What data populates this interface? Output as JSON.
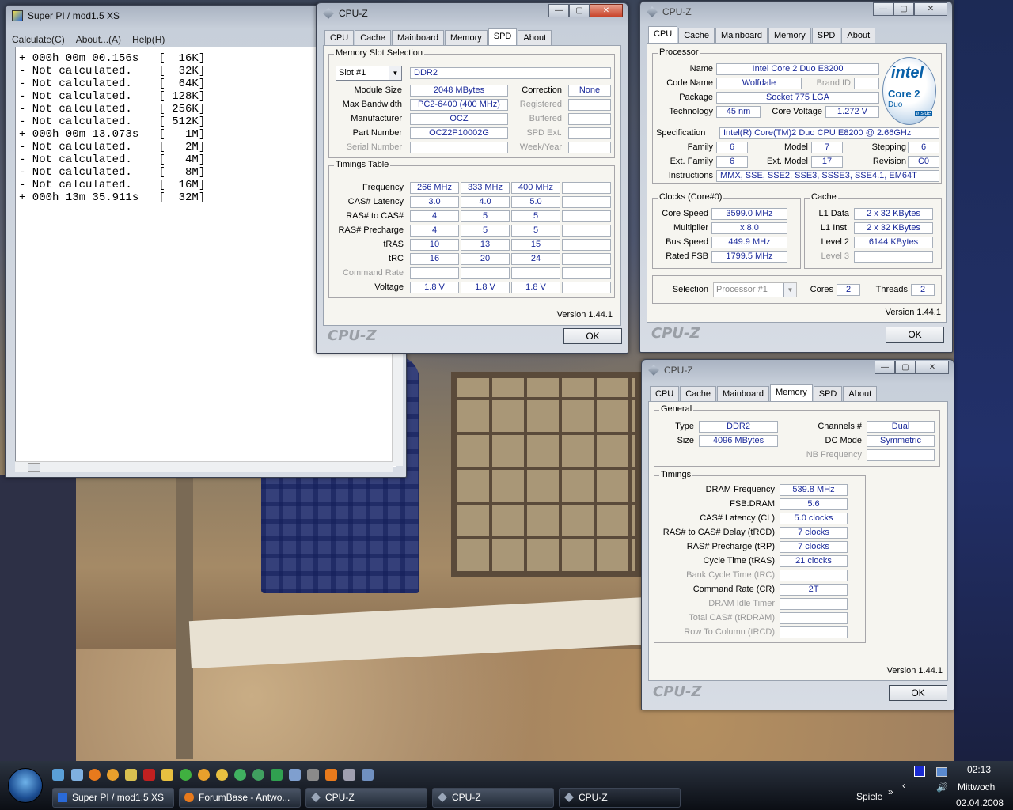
{
  "superpi": {
    "title": "Super PI / mod1.5 XS",
    "menu": [
      "Calculate(C)",
      "About...(A)",
      "Help(H)"
    ],
    "lines": [
      "+ 000h 00m 00.156s   [  16K]",
      "- Not calculated.    [  32K]",
      "- Not calculated.    [  64K]",
      "- Not calculated.    [ 128K]",
      "- Not calculated.    [ 256K]",
      "- Not calculated.    [ 512K]",
      "+ 000h 00m 13.073s   [   1M]",
      "- Not calculated.    [   2M]",
      "- Not calculated.    [   4M]",
      "- Not calculated.    [   8M]",
      "- Not calculated.    [  16M]",
      "+ 000h 13m 35.911s   [  32M]"
    ]
  },
  "cpuz_common": {
    "title": "CPU-Z",
    "brand": "CPU-Z",
    "version": "Version 1.44.1",
    "ok": "OK",
    "tabs": [
      "CPU",
      "Cache",
      "Mainboard",
      "Memory",
      "SPD",
      "About"
    ]
  },
  "spd": {
    "slot_group": "Memory Slot Selection",
    "slot": "Slot #1",
    "type": "DDR2",
    "labels_left": [
      "Module Size",
      "Max Bandwidth",
      "Manufacturer",
      "Part Number",
      "Serial Number"
    ],
    "values_left": [
      "2048 MBytes",
      "PC2-6400 (400 MHz)",
      "OCZ",
      "OCZ2P10002G",
      ""
    ],
    "labels_right": [
      "Correction",
      "Registered",
      "Buffered",
      "SPD Ext.",
      "Week/Year"
    ],
    "values_right": [
      "None",
      "",
      "",
      "",
      ""
    ],
    "timings_group": "Timings Table",
    "timing_labels": [
      "Frequency",
      "CAS# Latency",
      "RAS# to CAS#",
      "RAS# Precharge",
      "tRAS",
      "tRC",
      "Command Rate",
      "Voltage"
    ],
    "timing_cols": [
      [
        "266 MHz",
        "3.0",
        "4",
        "4",
        "10",
        "16",
        "",
        "1.8 V"
      ],
      [
        "333 MHz",
        "4.0",
        "5",
        "5",
        "13",
        "20",
        "",
        "1.8 V"
      ],
      [
        "400 MHz",
        "5.0",
        "5",
        "5",
        "15",
        "24",
        "",
        "1.8 V"
      ],
      [
        "",
        "",
        "",
        "",
        "",
        "",
        "",
        ""
      ]
    ]
  },
  "cpu": {
    "processor_group": "Processor",
    "name": "Intel Core 2 Duo E8200",
    "code_name": "Wolfdale",
    "brand_id_label": "Brand ID",
    "package": "Socket 775 LGA",
    "technology": "45 nm",
    "core_voltage_label": "Core Voltage",
    "core_voltage": "1.272 V",
    "spec_label": "Specification",
    "spec": "Intel(R) Core(TM)2 Duo CPU    E8200  @ 2.66GHz",
    "family": "6",
    "model": "7",
    "stepping": "6",
    "ext_family": "6",
    "ext_model": "17",
    "revision": "C0",
    "instructions": "MMX, SSE, SSE2, SSE3, SSSE3, SSE4.1, EM64T",
    "labels": {
      "name": "Name",
      "code_name": "Code Name",
      "package": "Package",
      "technology": "Technology",
      "family": "Family",
      "model": "Model",
      "stepping": "Stepping",
      "ext_family": "Ext. Family",
      "ext_model": "Ext. Model",
      "revision": "Revision",
      "instructions": "Instructions"
    },
    "clocks_group": "Clocks (Core#0)",
    "clock_labels": [
      "Core Speed",
      "Multiplier",
      "Bus Speed",
      "Rated FSB"
    ],
    "clock_values": [
      "3599.0 MHz",
      "x 8.0",
      "449.9 MHz",
      "1799.5 MHz"
    ],
    "cache_group": "Cache",
    "cache_labels": [
      "L1 Data",
      "L1 Inst.",
      "Level 2",
      "Level 3"
    ],
    "cache_values": [
      "2 x 32 KBytes",
      "2 x 32 KBytes",
      "6144 KBytes",
      ""
    ],
    "selection_label": "Selection",
    "selection": "Processor #1",
    "cores_label": "Cores",
    "cores": "2",
    "threads_label": "Threads",
    "threads": "2",
    "logo": {
      "brand": "intel",
      "line1": "Core 2",
      "line2": "Duo",
      "tag": "inside"
    }
  },
  "memory": {
    "general_group": "General",
    "type_label": "Type",
    "type": "DDR2",
    "size_label": "Size",
    "size": "4096 MBytes",
    "channels_label": "Channels #",
    "channels": "Dual",
    "dcmode_label": "DC Mode",
    "dcmode": "Symmetric",
    "nbfreq_label": "NB Frequency",
    "nbfreq": "",
    "timings_group": "Timings",
    "timing_labels": [
      "DRAM Frequency",
      "FSB:DRAM",
      "CAS# Latency (CL)",
      "RAS# to CAS# Delay (tRCD)",
      "RAS# Precharge (tRP)",
      "Cycle Time (tRAS)",
      "Bank Cycle Time (tRC)",
      "Command Rate (CR)",
      "DRAM Idle Timer",
      "Total CAS# (tRDRAM)",
      "Row To Column (tRCD)"
    ],
    "timing_values": [
      "539.8 MHz",
      "5:6",
      "5.0 clocks",
      "7 clocks",
      "7 clocks",
      "21 clocks",
      "",
      "2T",
      "",
      "",
      ""
    ],
    "timing_dim": [
      false,
      false,
      false,
      false,
      false,
      false,
      true,
      false,
      true,
      true,
      true
    ]
  },
  "taskbar": {
    "buttons": [
      "Super PI / mod1.5 XS",
      "ForumBase - Antwo...",
      "CPU-Z",
      "CPU-Z",
      "CPU-Z"
    ],
    "spiele": "Spiele",
    "time": "02:13",
    "day": "Mittwoch",
    "date": "02.04.2008"
  },
  "colors": {
    "value_text": "#1a2a9a",
    "intel_blue": "#0860a8"
  }
}
